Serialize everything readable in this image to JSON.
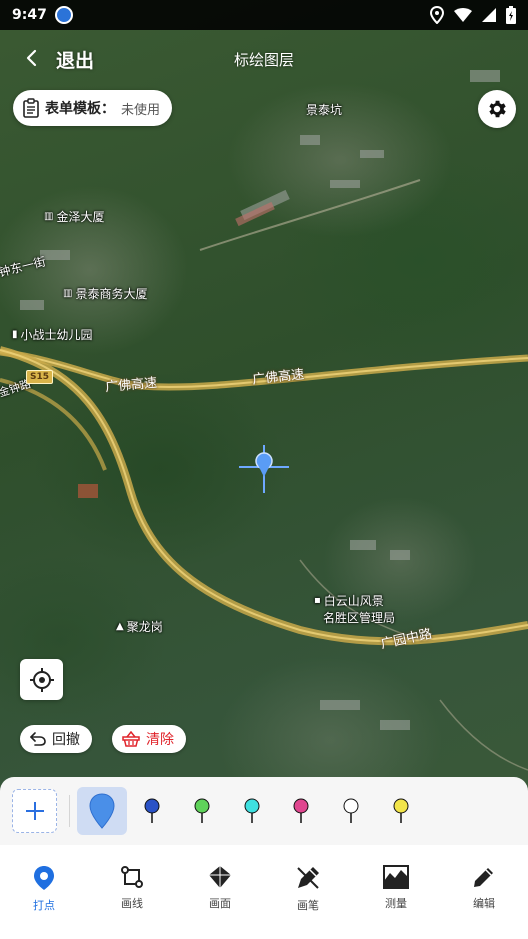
{
  "status_bar": {
    "time": "9:47"
  },
  "header": {
    "back_label": "退出",
    "title": "标绘图层"
  },
  "form_template": {
    "label": "表单模板：",
    "value": "未使用"
  },
  "map": {
    "pois": [
      {
        "name": "景泰坑",
        "glyph": ""
      },
      {
        "name": "金泽大厦",
        "glyph": "▥"
      },
      {
        "name": "钟东一街",
        "glyph": ""
      },
      {
        "name": "景泰商务大厦",
        "glyph": "▥"
      },
      {
        "name": "小战士幼儿园",
        "glyph": "▮"
      },
      {
        "name": "金钟路",
        "glyph": ""
      },
      {
        "name": "白云山风景",
        "glyph": ""
      },
      {
        "name": "名胜区管理局",
        "glyph": ""
      },
      {
        "name": "聚龙岗",
        "glyph": "▲"
      },
      {
        "name": "广园中路",
        "glyph": ""
      }
    ],
    "roads": {
      "expressway_1": "广佛高速",
      "expressway_2": "广佛高速",
      "shield": "S15"
    }
  },
  "actions": {
    "undo_label": "回撤",
    "clear_label": "清除"
  },
  "palette": {
    "markers": [
      {
        "color": "#4a8fe8",
        "selected": true
      },
      {
        "color": "#2a52c7",
        "selected": false
      },
      {
        "color": "#5fd35a",
        "selected": false
      },
      {
        "color": "#3ee0e0",
        "selected": false
      },
      {
        "color": "#e0468f",
        "selected": false
      },
      {
        "color": "#ffffff",
        "selected": false
      },
      {
        "color": "#f2e54a",
        "selected": false
      }
    ]
  },
  "toolbar": {
    "tools": [
      {
        "label": "打点",
        "icon": "location-pin-icon",
        "active": true
      },
      {
        "label": "画线",
        "icon": "polyline-icon",
        "active": false
      },
      {
        "label": "画面",
        "icon": "polygon-icon",
        "active": false
      },
      {
        "label": "画笔",
        "icon": "brush-icon",
        "active": false
      },
      {
        "label": "测量",
        "icon": "measure-icon",
        "active": false
      },
      {
        "label": "编辑",
        "icon": "pencil-icon",
        "active": false
      }
    ]
  },
  "colors": {
    "accent": "#1f6fe0",
    "clear": "#e0242b",
    "road": "#d9b44a"
  }
}
